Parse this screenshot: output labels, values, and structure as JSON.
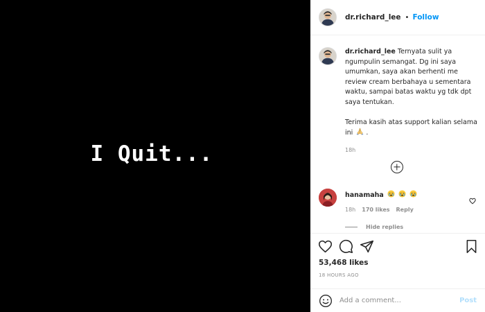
{
  "media": {
    "text": "I Quit..."
  },
  "header": {
    "username": "dr.richard_lee",
    "separator": "•",
    "follow_label": "Follow"
  },
  "caption": {
    "username": "dr.richard_lee",
    "text_1": "Ternyata sulit ya ngumpulin semangat. Dg ini saya umumkan, saya akan berhenti me review cream berbahaya u sementara waktu, sampai batas waktu yg tdk dpt saya tentukan.",
    "text_2": "Terima kasih atas support kalian selama ini",
    "time": "18h"
  },
  "comment": {
    "username": "hanamaha",
    "emoji_names": [
      "crying-face-icon",
      "crying-face-icon",
      "crying-face-icon"
    ],
    "time": "18h",
    "likes": "170 likes",
    "reply_label": "Reply",
    "hide_replies_label": "Hide replies"
  },
  "post": {
    "likes": "53,468 likes",
    "time": "18 HOURS AGO"
  },
  "add_comment": {
    "placeholder": "Add a comment...",
    "post_label": "Post"
  },
  "colors": {
    "accent": "#0095f6",
    "post_disabled": "#b2dffc",
    "muted": "#8e8e8e",
    "text": "#262626"
  }
}
